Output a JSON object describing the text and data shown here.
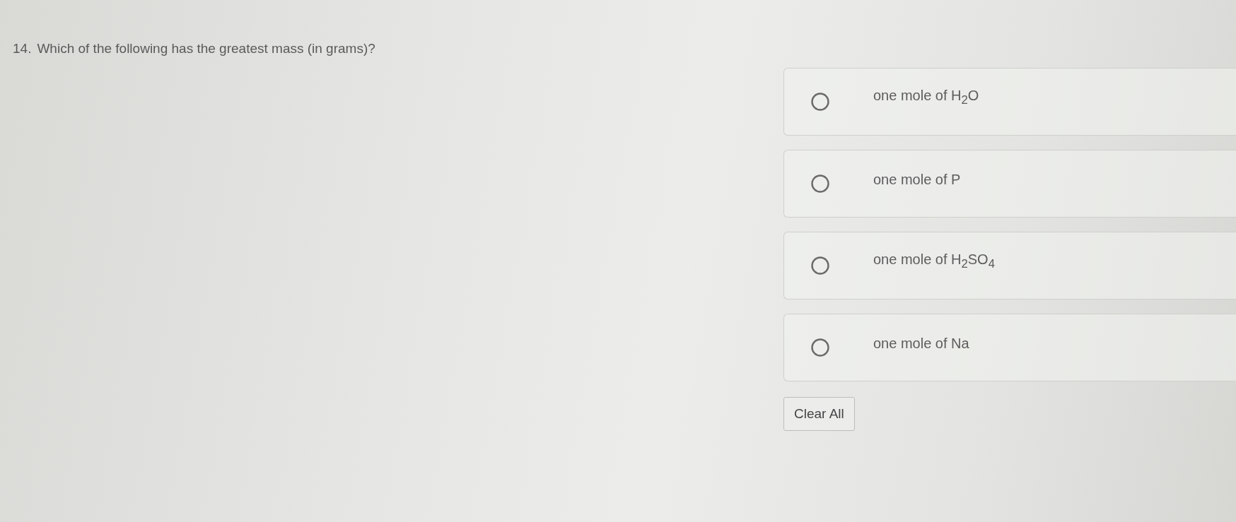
{
  "question": {
    "number": "14.",
    "text": "Which of the following has the greatest mass (in grams)?"
  },
  "options": [
    {
      "label": "one mole of H$_{2}$O",
      "selected": false
    },
    {
      "label": "one mole of P",
      "selected": false
    },
    {
      "label": "one mole of H$_{2}$SO$_{4}$",
      "selected": false
    },
    {
      "label": "one mole of Na",
      "selected": false
    }
  ],
  "clear_button": {
    "label": "Clear All"
  }
}
